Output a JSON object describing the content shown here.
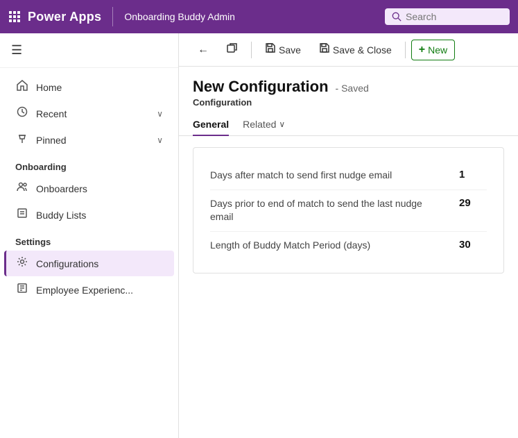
{
  "topbar": {
    "app_name": "Power Apps",
    "context": "Onboarding Buddy Admin",
    "search_placeholder": "Search"
  },
  "sidebar": {
    "hamburger_label": "☰",
    "nav_items": [
      {
        "id": "home",
        "label": "Home",
        "icon": "⌂",
        "has_chevron": false
      },
      {
        "id": "recent",
        "label": "Recent",
        "icon": "🕐",
        "has_chevron": true
      },
      {
        "id": "pinned",
        "label": "Pinned",
        "icon": "📌",
        "has_chevron": true
      }
    ],
    "sections": [
      {
        "label": "Onboarding",
        "items": [
          {
            "id": "onboarders",
            "label": "Onboarders",
            "icon": "👥"
          },
          {
            "id": "buddy-lists",
            "label": "Buddy Lists",
            "icon": "📋"
          }
        ]
      },
      {
        "label": "Settings",
        "items": [
          {
            "id": "configurations",
            "label": "Configurations",
            "icon": "⚙",
            "active": true
          },
          {
            "id": "employee-experience",
            "label": "Employee Experienc...",
            "icon": "📅"
          }
        ]
      }
    ]
  },
  "toolbar": {
    "back_label": "←",
    "restore_label": "⧉",
    "save_label": "Save",
    "save_close_label": "Save & Close",
    "new_label": "New"
  },
  "page": {
    "title": "New Configuration",
    "saved_status": "- Saved",
    "subtitle": "Configuration"
  },
  "tabs": [
    {
      "id": "general",
      "label": "General",
      "active": true
    },
    {
      "id": "related",
      "label": "Related",
      "active": false,
      "has_chevron": true
    }
  ],
  "form": {
    "fields": [
      {
        "label": "Days after match to send first nudge email",
        "value": "1"
      },
      {
        "label": "Days prior to end of match to send the last nudge email",
        "value": "29"
      },
      {
        "label": "Length of Buddy Match Period (days)",
        "value": "30"
      }
    ]
  }
}
